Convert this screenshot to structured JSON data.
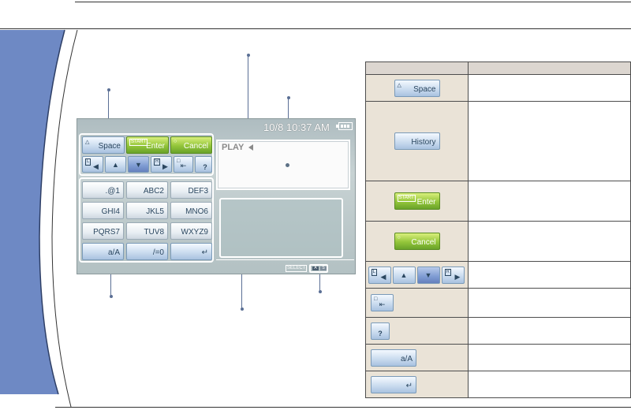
{
  "status": {
    "datetime": "10/8 10:37 AM"
  },
  "keys": {
    "space": {
      "symbol": "△",
      "label": "Space"
    },
    "enter": {
      "tag": "START",
      "label": "Enter"
    },
    "cancel": {
      "symbol": "○",
      "label": "Cancel"
    },
    "nav_l": "L",
    "nav_r": "R",
    "backspace": "□",
    "help": "?"
  },
  "keypad": ".@1,ABC2,DEF3,GHI4,JKL5,MNO6,PQRS7,TUV8,WXYZ9,a/A,/=0,↵",
  "keypad_list": [
    ".@1",
    "ABC2",
    "DEF3",
    "GHI4",
    "JKL5",
    "MNO6",
    "PQRS7",
    "TUV8",
    "WXYZ9",
    "a/A",
    "/=0",
    "↵"
  ],
  "play_text": "PLAY",
  "select_tag": "SELECT",
  "mode_indicator": [
    "A",
    "S"
  ],
  "legend": {
    "space": {
      "symbol": "△",
      "label": "Space"
    },
    "history": {
      "label": "History"
    },
    "enter": {
      "tag": "START",
      "label": "Enter"
    },
    "cancel": {
      "symbol": "○",
      "label": "Cancel"
    },
    "nav": {
      "l": "L",
      "r": "R"
    },
    "backspace": {
      "symbol": "□"
    },
    "help": {
      "label": "?"
    },
    "case": {
      "label": "a/A"
    },
    "newline": {
      "label": "↵"
    }
  },
  "colors": {
    "accent_blue": "#6b8fc9",
    "pointer": "#5b6f95",
    "key_green": "#93c53a"
  }
}
